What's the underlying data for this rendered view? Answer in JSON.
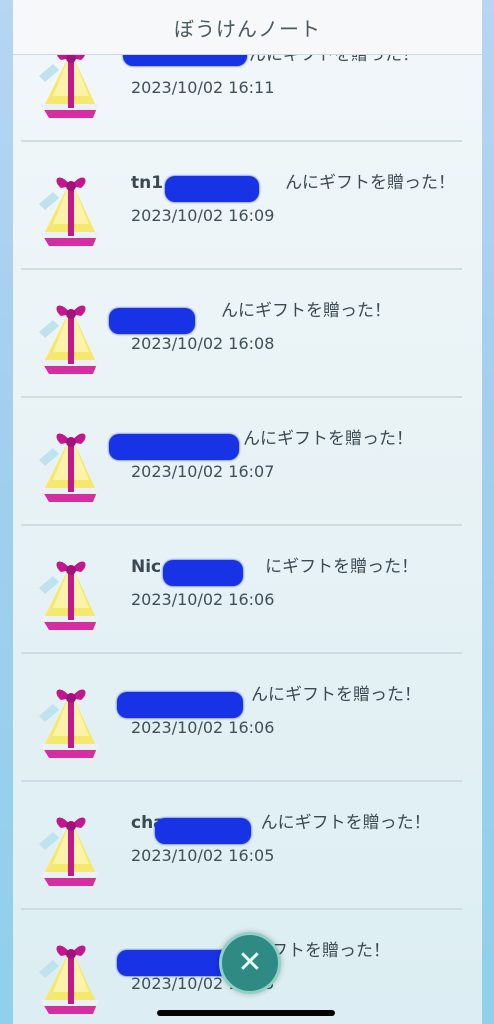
{
  "header": {
    "title": "ぼうけんノート"
  },
  "entries": [
    {
      "name_prefix": "",
      "message": "んにギフトを贈った！",
      "timestamp": "2023/10/02 16:11"
    },
    {
      "name_prefix": "tn1",
      "message": "んにギフトを贈った！",
      "timestamp": "2023/10/02 16:09"
    },
    {
      "name_prefix": "",
      "message": "んにギフトを贈った！",
      "timestamp": "2023/10/02 16:08"
    },
    {
      "name_prefix": "",
      "message": "んにギフトを贈った！",
      "timestamp": "2023/10/02 16:07"
    },
    {
      "name_prefix": "Nic",
      "message": "にギフトを贈った！",
      "timestamp": "2023/10/02 16:06"
    },
    {
      "name_prefix": "",
      "message": "んにギフトを贈った！",
      "timestamp": "2023/10/02 16:06"
    },
    {
      "name_prefix": "cha",
      "message": "んにギフトを贈った！",
      "timestamp": "2023/10/02 16:05"
    },
    {
      "name_prefix": "",
      "message": "フトを贈った！",
      "timestamp": "2023/10/02 16:05"
    }
  ],
  "close_button": {
    "icon": "close-icon",
    "glyph": "✕"
  },
  "colors": {
    "accent": "#2f8a84",
    "redaction": "#1833e6",
    "ribbon": "#c2188f",
    "gift_yellow": "#f6e86a"
  }
}
